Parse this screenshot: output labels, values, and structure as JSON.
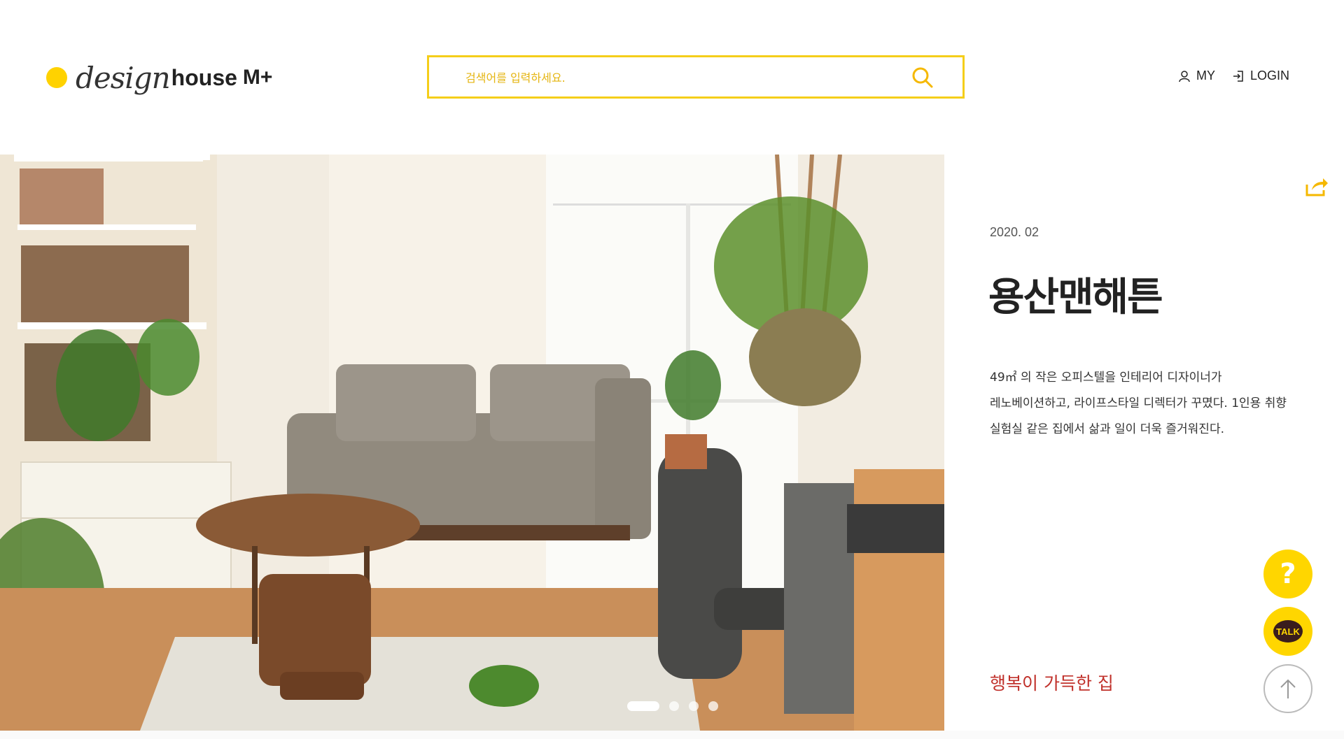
{
  "header": {
    "logo": {
      "part1": "design",
      "part2": "house",
      "part3": "M+"
    },
    "search": {
      "placeholder": "검색어를 입력하세요."
    },
    "nav": [
      {
        "label": "MY",
        "icon": "person-icon"
      },
      {
        "label": "LOGIN",
        "icon": "login-icon"
      }
    ]
  },
  "article": {
    "date": "2020. 02",
    "title": "용산맨해튼",
    "description": "49㎡ 의 작은 오피스텔을 인테리어 디자이너가 레노베이션하고, 라이프스타일 디렉터가 꾸몄다. 1인용 취향 실험실 같은 집에서 삶과 일이 더욱 즐거워진다.",
    "tag": "행복이 가득한 집"
  },
  "slider": {
    "total": 4,
    "active": 1
  },
  "fabs": {
    "help": "?",
    "talk": "TALK"
  },
  "colors": {
    "accent": "#FFD200",
    "search_border": "#F5CE1A",
    "tag": "#C0312B"
  }
}
